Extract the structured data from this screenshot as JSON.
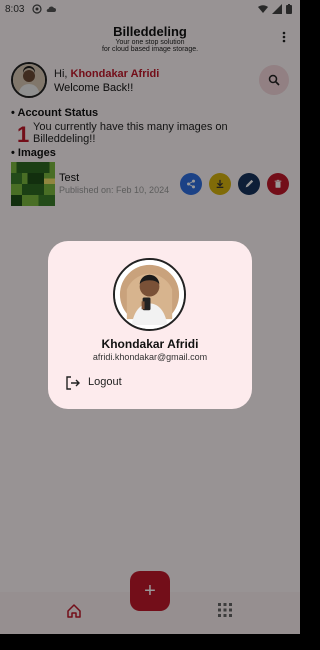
{
  "status_bar": {
    "time": "8:03"
  },
  "header": {
    "title": "Billeddeling",
    "subtitle_line1": "Your one stop solution",
    "subtitle_line2": "for cloud based image storage."
  },
  "user": {
    "greeting_prefix": "Hi, ",
    "name": "Khondakar Afridi",
    "welcome": "Welcome Back!!"
  },
  "account": {
    "heading": "• Account Status",
    "count": "1",
    "message": "You currently have this many images on Billeddeling!!"
  },
  "images": {
    "heading": "• Images",
    "items": [
      {
        "title": "Test",
        "date": "Published on: Feb 10, 2024"
      }
    ]
  },
  "profile_dialog": {
    "name": "Khondakar Afridi",
    "email": "afridi.khondakar@gmail.com",
    "logout_label": "Logout"
  },
  "bottom_nav": {
    "fab_label": "+"
  },
  "colors": {
    "accent": "#c0182a",
    "share": "#2f6fe0",
    "download": "#d6b20e",
    "edit": "#16325c",
    "delete": "#c0182a",
    "dialog_bg": "#fdebed"
  },
  "icons": {
    "search": "search-icon",
    "menu": "more-vert-icon",
    "share": "share-icon",
    "download": "download-icon",
    "edit": "edit-icon",
    "delete": "delete-icon",
    "logout": "logout-icon",
    "home": "home-icon",
    "grid": "grid-icon",
    "add": "add-icon"
  }
}
